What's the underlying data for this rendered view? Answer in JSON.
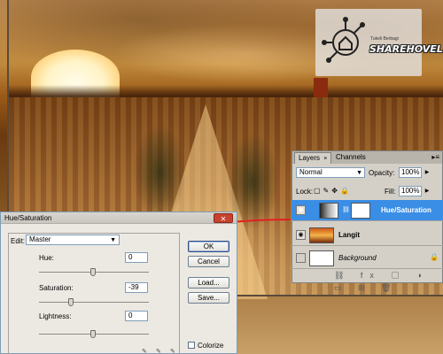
{
  "watermark": {
    "brand": "SHAREHOVEL",
    "tagline": "Tukeli Berbagi"
  },
  "hue_saturation": {
    "title": "Hue/Saturation",
    "close_label": "✕",
    "edit_label": "Edit:",
    "edit_value": "Master",
    "hue_label": "Hue:",
    "hue_value": "0",
    "saturation_label": "Saturation:",
    "saturation_value": "-39",
    "lightness_label": "Lightness:",
    "lightness_value": "0",
    "ok_label": "OK",
    "cancel_label": "Cancel",
    "load_label": "Load...",
    "save_label": "Save...",
    "colorize_label": "Colorize",
    "colorize_checked": false
  },
  "layers_panel": {
    "tabs": [
      {
        "label": "Layers",
        "active": true
      },
      {
        "label": "Channels",
        "active": false
      }
    ],
    "tab_close": "×",
    "menu_glyph": "▸≡",
    "blend_mode": "Normal",
    "opacity_label": "Opacity:",
    "opacity_value": "100%",
    "lock_label": "Lock:",
    "fill_label": "Fill:",
    "fill_value": "100%",
    "layers": [
      {
        "name": "Hue/Saturation",
        "selected": true,
        "icon": "adjustment-layer-icon"
      },
      {
        "name": "Langit",
        "selected": false,
        "icon": "sky-thumbnail"
      },
      {
        "name": "Background",
        "selected": false,
        "icon": "background-thumbnail"
      }
    ],
    "footer_icons": "⛓ fx ◻ ◑ ▭ ⊞ 🗑"
  },
  "colors": {
    "selection": "#3a8ee6",
    "annotation_line": "#e02020",
    "dialog_bg": "#ece9e2"
  }
}
